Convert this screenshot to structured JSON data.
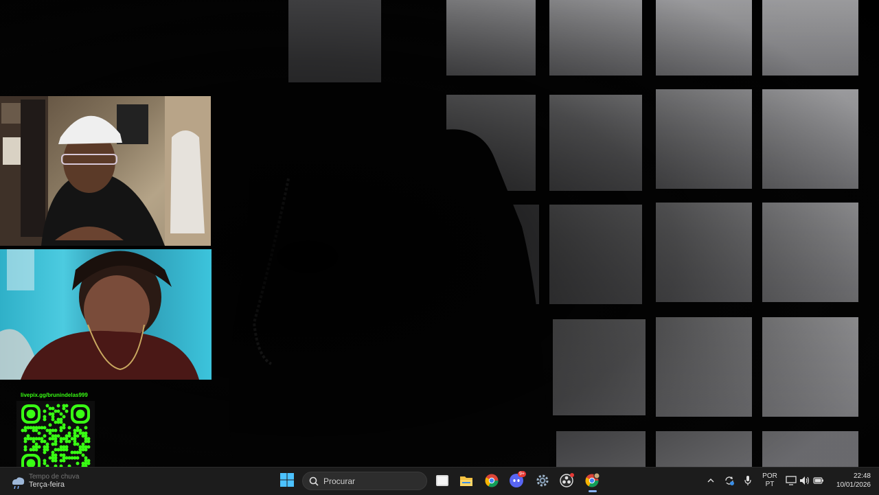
{
  "overlay": {
    "qr_url": "livepix.gg/brunindelas999"
  },
  "taskbar": {
    "weather": {
      "line1": "Tempo de chuva",
      "line2": "Terça-feira",
      "icon": "rain-cloud-icon"
    },
    "start_icon": "windows-start-icon",
    "search": {
      "placeholder": "Procurar",
      "icon": "search-icon"
    },
    "apps": [
      {
        "name": "task-view",
        "icon": "task-view-icon"
      },
      {
        "name": "file-explorer",
        "icon": "folder-icon"
      },
      {
        "name": "chrome",
        "icon": "chrome-icon"
      },
      {
        "name": "discord",
        "icon": "discord-icon",
        "badge": "9+"
      },
      {
        "name": "settings",
        "icon": "gear-icon"
      },
      {
        "name": "obs",
        "icon": "obs-icon"
      },
      {
        "name": "chrome-active",
        "icon": "chrome-icon"
      }
    ],
    "tray": {
      "chevron_icon": "chevron-up-icon",
      "sync_icon": "sync-icon",
      "mic_icon": "microphone-icon",
      "lang_line1": "POR",
      "lang_line2": "PT",
      "network_icon": "network-icon",
      "volume_icon": "volume-icon",
      "battery_icon": "battery-icon"
    },
    "clock": {
      "time": "22:48",
      "date": "10/01/2026"
    }
  },
  "colors": {
    "qr_green": "#39ff14",
    "taskbar_bg": "#1c1c1c",
    "accent": "#8ab4f8"
  }
}
